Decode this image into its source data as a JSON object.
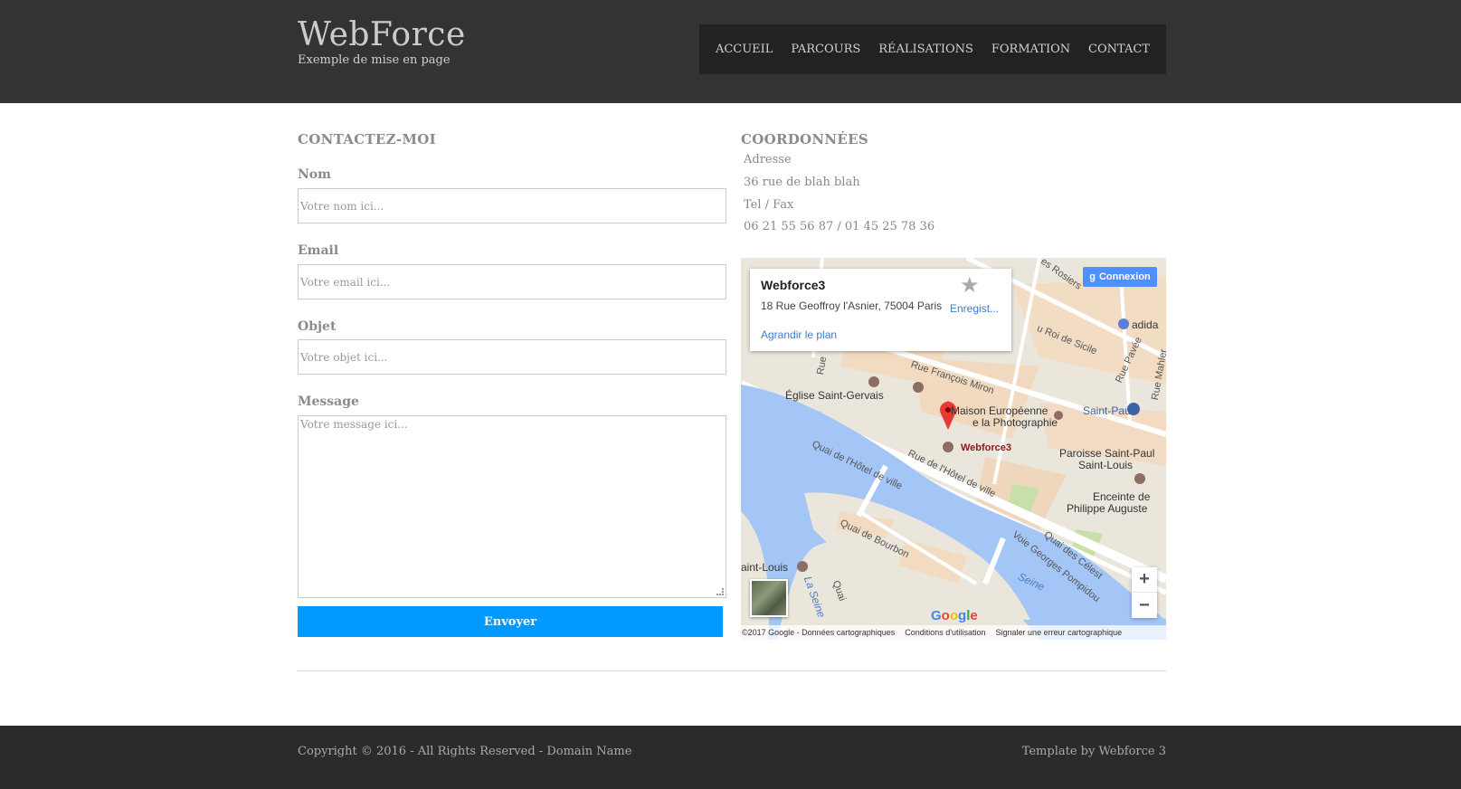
{
  "header": {
    "logo": "WebForce",
    "tagline": "Exemple de mise en page",
    "nav": [
      "ACCUEIL",
      "PARCOURS",
      "RÉALISATIONS",
      "FORMATION",
      "CONTACT"
    ]
  },
  "contact_form": {
    "title": "CONTACTEZ-MOI",
    "name_label": "Nom",
    "name_placeholder": "Votre nom ici...",
    "email_label": "Email",
    "email_placeholder": "Votre email ici...",
    "subject_label": "Objet",
    "subject_placeholder": "Votre objet ici...",
    "message_label": "Message",
    "message_placeholder": "Votre message ici...",
    "submit_label": "Envoyer"
  },
  "coordinates": {
    "title": "COORDONNÉES",
    "address_label": "Adresse",
    "address_value": "36 rue de blah blah",
    "phone_label": "Tel / Fax",
    "phone_value": "06 21 55 56 87 / 01 45 25 78 36"
  },
  "map": {
    "place_name": "Webforce3",
    "place_address": "18 Rue Geoffroy l'Asnier, 75004 Paris",
    "save_label": "Enregist...",
    "enlarge_link": "Agrandir le plan",
    "connect_button": "Connexion",
    "zoom_in": "+",
    "zoom_out": "−",
    "brand": "Google",
    "labels": {
      "eglise": "Église Saint-Gervais",
      "quai_hotel": "Quai de l'Hôtel de ville",
      "rue_hotel": "Rue de l'Hôtel de ville",
      "rue_francois": "Rue François Miron",
      "maison1": "Maison Européenne",
      "maison2": "e la Photographie",
      "marker": "Webforce3",
      "saint_paul": "Saint-Paul",
      "paroisse1": "Paroisse Saint-Paul",
      "paroisse2": "Saint-Louis",
      "enceinte1": "Enceinte de",
      "enceinte2": "Philippe Auguste",
      "quai_bourbon": "Quai de Bourbon",
      "voie_pompidou": "Voie Georges Pompidou",
      "quai_celestins": "Quai des Célest",
      "seine": "Seine",
      "la_seine": "La Seine",
      "saint_louis": "aint-Louis",
      "roi_sicile": "u Roi de Sicile",
      "rosiers": "es Rosiers",
      "adida": "adida",
      "rue_pavee": "Rue Pavée",
      "rue_mahler": "Rue Mahler",
      "rue_left": "Rue",
      "quai_left": "Quai"
    },
    "footer": [
      "©2017 Google - Données cartographiques",
      "Conditions d'utilisation",
      "Signaler une erreur cartographique"
    ]
  },
  "footer": {
    "copyright": "Copyright © 2016 - All Rights Reserved - Domain Name",
    "credit": "Template by Webforce 3"
  },
  "colors": {
    "header_bg": "#333333",
    "nav_bg": "#222222",
    "submit_bg": "#0099ff",
    "footer_bg": "#2b2b2b",
    "water": "#a3c6f7",
    "marker": "#e53935"
  }
}
